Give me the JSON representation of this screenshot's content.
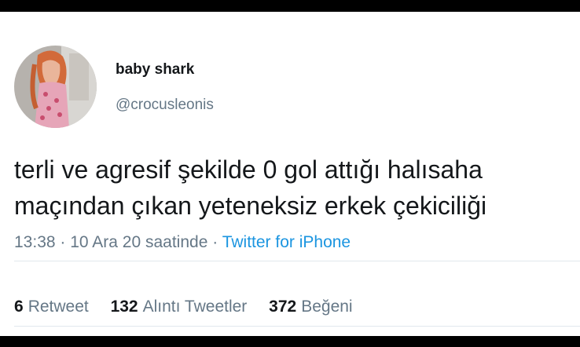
{
  "user": {
    "display_name": "baby shark",
    "handle": "@crocusleonis"
  },
  "tweet": {
    "line1": "terli ve agresif şekilde 0 gol attığı halısaha",
    "line2": "maçından çıkan yeteneksiz erkek çekiciliği"
  },
  "meta": {
    "time": "13:38",
    "separator1": "·",
    "date": "10 Ara 20 saatinde",
    "separator2": "·",
    "source": "Twitter for iPhone"
  },
  "stats": {
    "retweets_count": "6",
    "retweets_label": "Retweet",
    "quotes_count": "132",
    "quotes_label": "Alıntı Tweetler",
    "likes_count": "372",
    "likes_label": "Beğeni"
  },
  "colors": {
    "link": "#1b95e0",
    "text": "#14171a",
    "secondary": "#657786"
  }
}
